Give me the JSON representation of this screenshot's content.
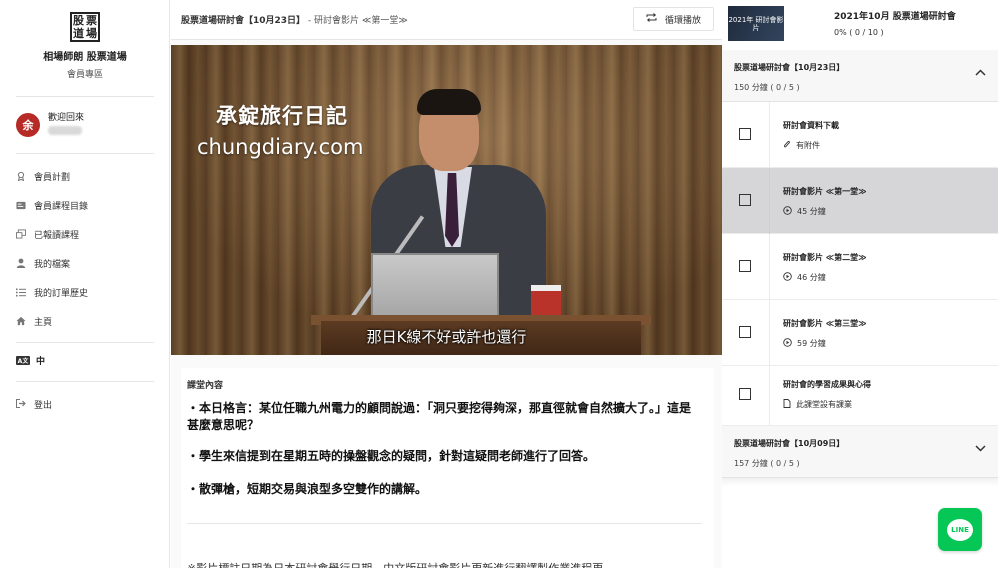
{
  "sidebar": {
    "logo_chars": [
      "股",
      "票",
      "道",
      "場"
    ],
    "brand_name": "相場師朗 股票道場",
    "brand_sub": "會員專區",
    "avatar_initial": "余",
    "welcome": "歡迎回來",
    "nav": [
      {
        "label": "會員計劃",
        "icon": "badge-icon"
      },
      {
        "label": "會員課程目錄",
        "icon": "card-icon"
      },
      {
        "label": "已報讀課程",
        "icon": "courses-icon"
      },
      {
        "label": "我的檔案",
        "icon": "user-icon"
      },
      {
        "label": "我的訂單歷史",
        "icon": "list-icon"
      },
      {
        "label": "主頁",
        "icon": "home-icon"
      }
    ],
    "lang_badge": "A文",
    "lang_label": "中",
    "logout": "登出"
  },
  "topbar": {
    "crumb_title": "股票道場研討會【10月23日】",
    "crumb_sub": " - 研討會影片 ≪第一堂≫",
    "loop_label": "循環播放"
  },
  "video": {
    "watermark_title": "承錠旅行日記",
    "watermark_url": "chungdiary.com",
    "subtitle": "那日K線不好或許也還行"
  },
  "content": {
    "title": "課堂內容",
    "paragraphs": [
      "・本日格言：某位任職九州電力的顧問說過：「洞只要挖得夠深，那直徑就會自然擴大了。」這是甚麼意思呢？",
      "・學生來信提到在星期五時的操盤觀念的疑問，針對這疑問老師進行了回答。",
      "・散彈槍，短期交易與浪型多空雙作的講解。"
    ],
    "footnote": "※影片標註日期為日本研討會舉行日期，中文版研討會影片更新進行翻譯製作業進程更"
  },
  "course": {
    "thumb_text": "2021年 研討會影片",
    "title": "2021年10月 股票道場研討會",
    "progress": "0% ( 0 / 10 )"
  },
  "sections": [
    {
      "title": "股票道場研討會【10月23日】",
      "sub": "150 分鐘 ( 0 / 5 )",
      "chevron": "⌃"
    },
    {
      "title": "股票道場研討會【10月09日】",
      "sub": "157 分鐘 ( 0 / 5 )",
      "chevron": "⌄"
    }
  ],
  "lessons": [
    {
      "title": "研討會資料下載",
      "meta": "有附件",
      "icon": "paperclip-icon"
    },
    {
      "title": "研討會影片 ≪第一堂≫",
      "meta": "45 分鐘",
      "icon": "play-icon",
      "active": true
    },
    {
      "title": "研討會影片 ≪第二堂≫",
      "meta": "46 分鐘",
      "icon": "play-icon"
    },
    {
      "title": "研討會影片 ≪第三堂≫",
      "meta": "59 分鐘",
      "icon": "play-icon"
    },
    {
      "title": "研討會的學習成果與心得",
      "meta": "此課堂設有課業",
      "icon": "document-icon"
    }
  ],
  "line_button": "LINE",
  "colors": {
    "avatar": "#b72b27",
    "line": "#06c755",
    "active_lesson": "#d6d6d8"
  }
}
